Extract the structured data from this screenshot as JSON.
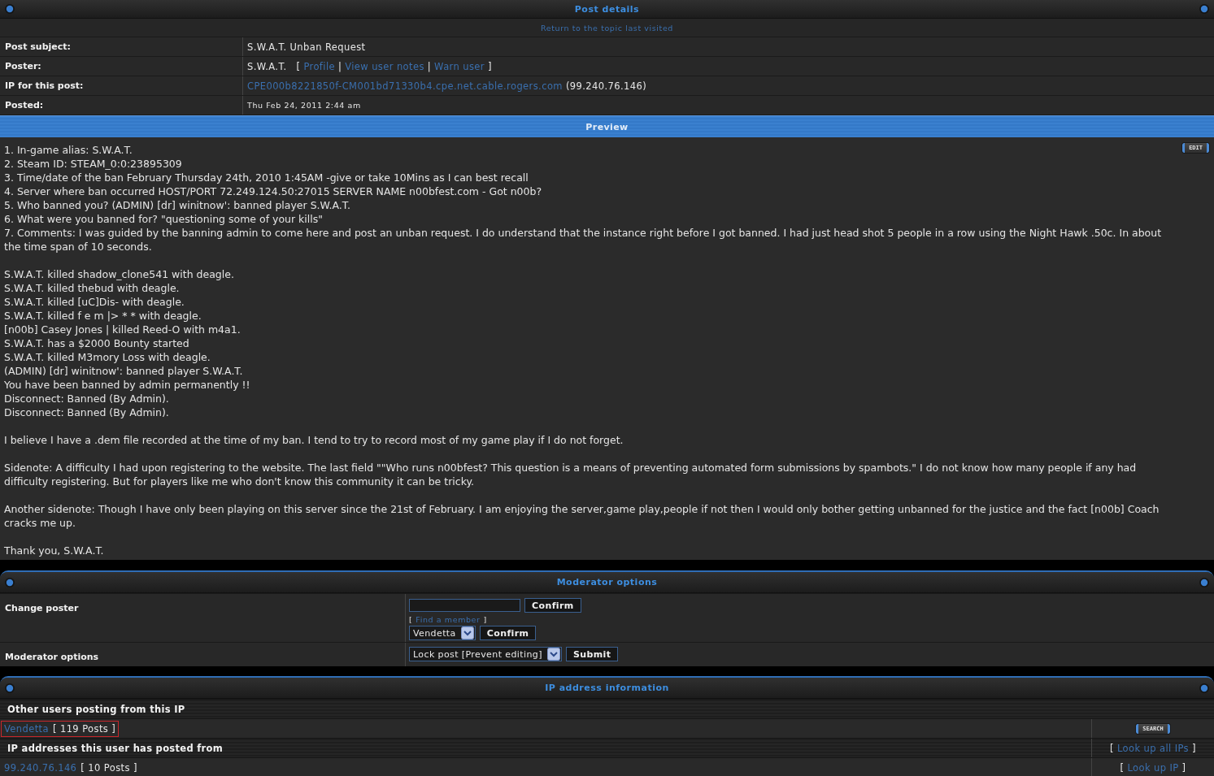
{
  "post_details": {
    "title": "Post details",
    "return_link": "Return to the topic last visited",
    "rows": [
      {
        "kind": "text",
        "label": "Post subject:",
        "value": "S.W.A.T. Unban Request"
      },
      {
        "kind": "user",
        "label": "Poster:",
        "value": "S.W.A.T.",
        "open": "[",
        "links": [
          "Profile",
          "View user notes",
          "Warn user"
        ],
        "separator": "|",
        "close": "]"
      },
      {
        "kind": "host",
        "label": "IP for this post:",
        "link": "CPE000b8221850f-CM001bd71330b4.cpe.net.cable.rogers.com",
        "value": "(99.240.76.146)"
      },
      {
        "kind": "date",
        "label": "Posted:",
        "value": "Thu Feb 24, 2011 2:44 am"
      }
    ]
  },
  "preview": {
    "title": "Preview",
    "edit_button": "EDIT",
    "paragraphs": [
      [
        "1. In-game alias: S.W.A.T.",
        "2. Steam ID: STEAM_0:0:23895309",
        "3. Time/date of the ban February Thursday 24th, 2010 1:45AM -give or take 10Mins as I can best recall",
        "4. Server where ban occurred HOST/PORT 72.249.124.50:27015 SERVER NAME n00bfest.com - Got n00b?",
        "5. Who banned you? (ADMIN) [dr] winitnow': banned player S.W.A.T.",
        "6. What were you banned for? \"questioning some of your kills\"",
        "7. Comments: I was guided by the banning admin to come here and post an unban request. I do understand that the instance right before I got banned. I had just head shot 5 people in a row using the Night Hawk .50c. In about the time span of 10 seconds."
      ],
      [
        "S.W.A.T. killed shadow_clone541 with deagle.",
        "S.W.A.T. killed thebud with deagle.",
        "S.W.A.T. killed [uC]Dis- with deagle.",
        "S.W.A.T. killed f e m |> * * with deagle.",
        "[n00b] Casey Jones | killed Reed-O with m4a1.",
        "S.W.A.T. has a $2000 Bounty started",
        "S.W.A.T. killed M3mory Loss with deagle.",
        "(ADMIN) [dr] winitnow': banned player S.W.A.T.",
        "You have been banned by admin permanently !!",
        "Disconnect: Banned (By Admin).",
        "Disconnect: Banned (By Admin)."
      ],
      [
        "I believe I have a .dem file recorded at the time of my ban. I tend to try to record most of my game play if I do not forget."
      ],
      [
        "Sidenote: A difficulty I had upon registering to the website. The last field \"\"Who runs n00bfest? This question is a means of preventing automated form submissions by spambots.\" I do not know how many people if any had difficulty registering. But for players like me who don't know this community it can be tricky."
      ],
      [
        "Another sidenote: Though I have only been playing on this server since the 21st of February. I am enjoying the server,game play,people if not then I would only bother getting unbanned for the justice and the fact [n00b] Coach cracks me up."
      ],
      [
        "Thank you, S.W.A.T."
      ]
    ]
  },
  "moderator_options": {
    "title": "Moderator options",
    "rows": [
      {
        "kind": "change_poster",
        "label": "Change poster",
        "button": "Confirm",
        "find_open": "[",
        "find_link": "Find a member",
        "find_close": "]",
        "select": "Vendetta",
        "select_button": "Confirm"
      },
      {
        "kind": "mod_action",
        "label": "Moderator options",
        "select": "Lock post [Prevent editing]",
        "button": "Submit"
      }
    ]
  },
  "ip_info": {
    "title": "IP address information",
    "sections": [
      {
        "heading": "Other users posting from this IP",
        "items": [
          {
            "link": "Vendetta",
            "count": "[ 119 Posts ]",
            "highlighted": true,
            "action": {
              "kind": "search_button",
              "label": "SEARCH"
            }
          }
        ]
      },
      {
        "heading": "IP addresses this user has posted from",
        "heading_action": {
          "open": "[",
          "link": "Look up all IPs",
          "close": "]"
        },
        "items": [
          {
            "link": "99.240.76.146",
            "count": "[ 10 Posts ]",
            "highlighted": false,
            "action": {
              "kind": "bracket_link",
              "open": "[",
              "link": "Look up IP",
              "close": "]"
            }
          }
        ]
      }
    ]
  }
}
